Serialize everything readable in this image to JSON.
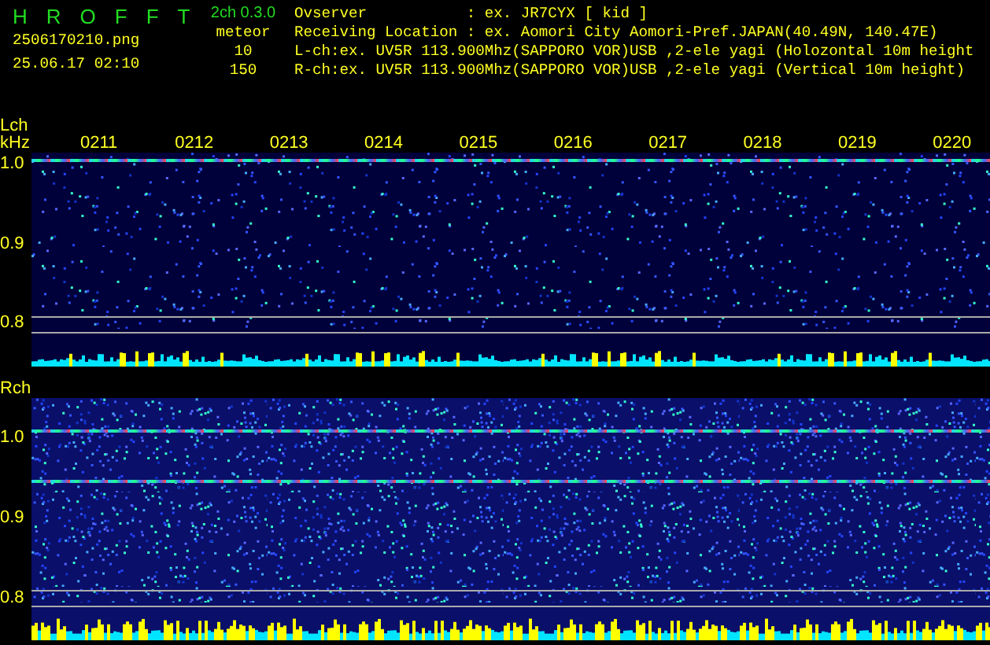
{
  "header": {
    "title": "HROFFT",
    "version": "2ch 0.3.0",
    "filename": "2506170210.png",
    "datetime": "25.06.17 02:10",
    "mode": "meteor",
    "counts": [
      "10",
      "150"
    ],
    "info": [
      "Ovserver           : ex. JR7CYX [ kid ]",
      "Receiving Location : ex. Aomori City Aomori-Pref.JAPAN(40.49N, 140.47E)",
      "L-ch:ex. UV5R 113.900Mhz(SAPPORO VOR)USB ,2-ele yagi (Holozontal 10m height",
      "R-ch:ex. UV5R 113.900Mhz(SAPPORO VOR)USB ,2-ele yagi (Vertical 10m height)"
    ]
  },
  "channels": [
    {
      "label": "Lch",
      "unit": "kHz",
      "times": [
        "0211",
        "0212",
        "0213",
        "0214",
        "0215",
        "0216",
        "0217",
        "0218",
        "0219",
        "0220"
      ],
      "yticks": [
        "1.0",
        "0.9",
        "0.8"
      ]
    },
    {
      "label": "Rch",
      "yticks": [
        "1.0",
        "0.9",
        "0.8"
      ]
    }
  ]
}
